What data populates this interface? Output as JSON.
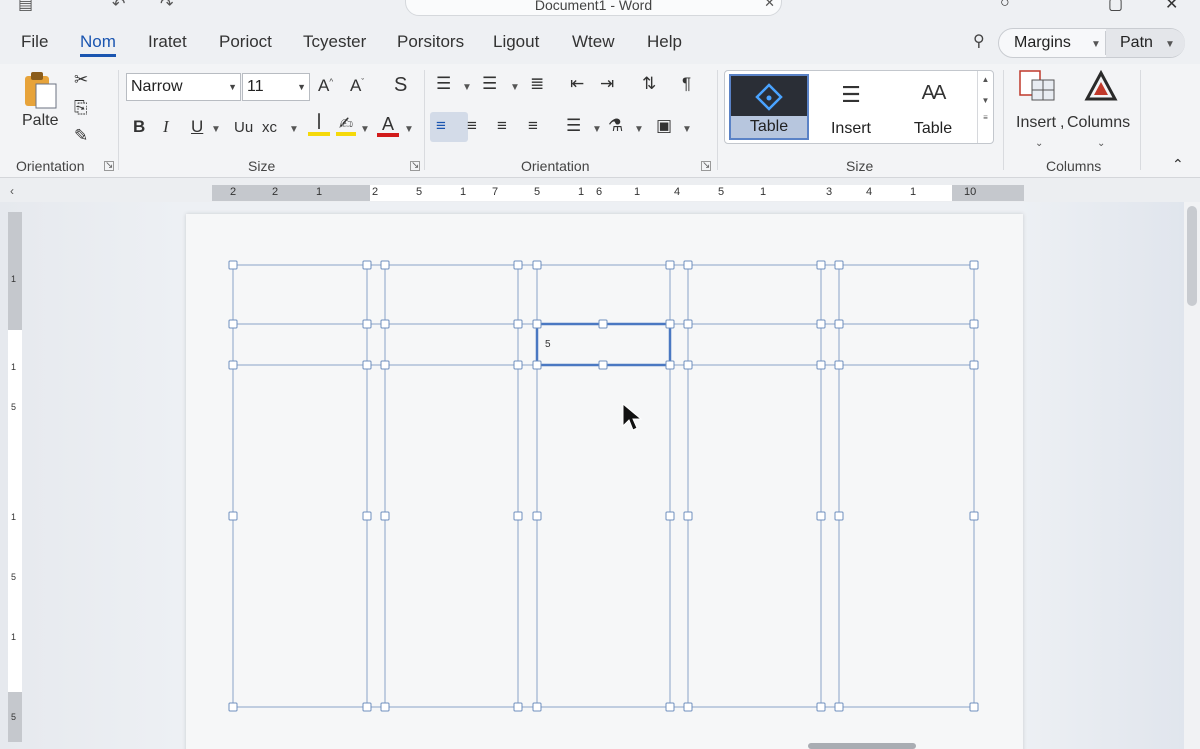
{
  "window": {
    "title": "Document1 - Word"
  },
  "menu": {
    "items": [
      "File",
      "Nom",
      "Iratet",
      "Porioct",
      "Tcyester",
      "Porsitors",
      "Ligout",
      "Wtew",
      "Help"
    ],
    "active": "Nom",
    "margins_label": "Margins",
    "patn_label": "Patn"
  },
  "ribbon": {
    "clipboard": {
      "paste_label": "Palte",
      "group_label": "Orientation"
    },
    "font": {
      "font_name": "Narrow",
      "font_size": "11",
      "grow_label": "A",
      "shrink_label": "A",
      "bold": "B",
      "italic": "I",
      "underline": "U",
      "strike_label": "Uu",
      "sub_label": "xc",
      "font_color_label": "A",
      "group_label": "Size",
      "highlight_color": "#f5d90a",
      "font_color": "#d11b1b"
    },
    "paragraph": {
      "group_label": "Orientation"
    },
    "styles": {
      "items": [
        "Table",
        "Insert",
        "Table"
      ],
      "selected_index": 0,
      "group_label": "Size"
    },
    "columns": {
      "insert_label": "Insert",
      "columns_label": "Columns",
      "separator": ",",
      "group_label": "Columns"
    }
  },
  "ruler": {
    "labels": [
      "2",
      "2",
      "1",
      "2",
      "5",
      "1",
      "7",
      "5",
      "1",
      "6",
      "1",
      "4",
      "5",
      "1",
      "3",
      "4",
      "1",
      "10"
    ]
  },
  "vruler": {
    "labels": [
      "1",
      "1",
      "5",
      "1",
      "5",
      "1",
      "5"
    ]
  },
  "document": {
    "selected_cell_text": "5"
  },
  "colors": {
    "accent": "#1a55b0",
    "table_line": "#8aa3c8",
    "selected_cell": "#4a78c2"
  }
}
